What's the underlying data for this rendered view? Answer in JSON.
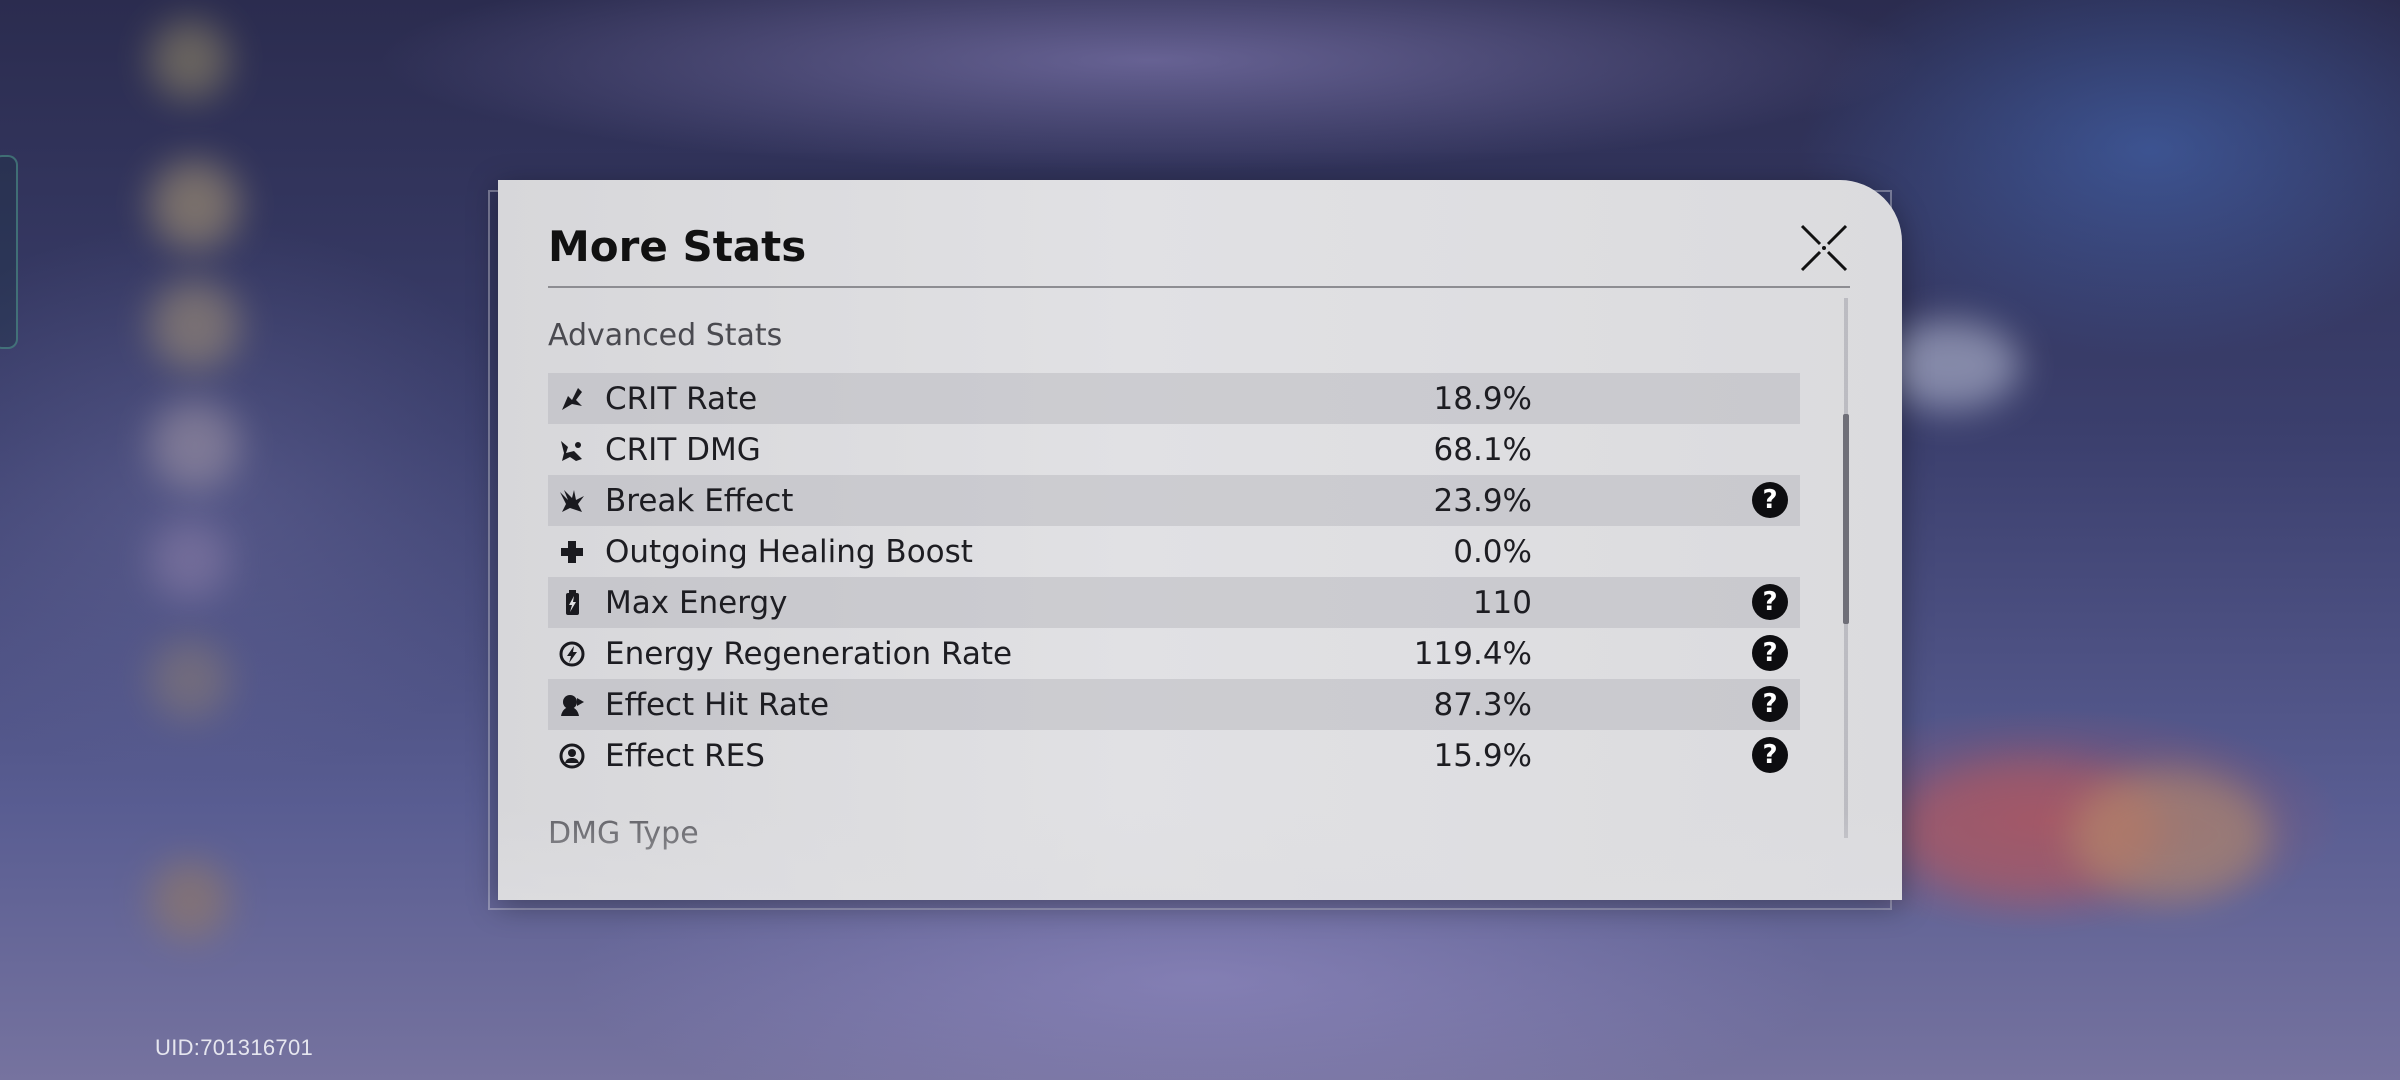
{
  "modal": {
    "title": "More Stats",
    "close_icon": "close-x-icon"
  },
  "advanced_stats": {
    "heading": "Advanced Stats",
    "rows": [
      {
        "label": "CRIT Rate",
        "value": "18.9%",
        "icon": "crit-rate-icon",
        "help": false
      },
      {
        "label": "CRIT DMG",
        "value": "68.1%",
        "icon": "crit-dmg-icon",
        "help": false
      },
      {
        "label": "Break Effect",
        "value": "23.9%",
        "icon": "break-effect-icon",
        "help": true
      },
      {
        "label": "Outgoing Healing Boost",
        "value": "0.0%",
        "icon": "healing-cross-icon",
        "help": false
      },
      {
        "label": "Max Energy",
        "value": "110",
        "icon": "battery-icon",
        "help": true
      },
      {
        "label": "Energy Regeneration Rate",
        "value": "119.4%",
        "icon": "energy-regen-icon",
        "help": true
      },
      {
        "label": "Effect Hit Rate",
        "value": "87.3%",
        "icon": "effect-hit-icon",
        "help": true
      },
      {
        "label": "Effect RES",
        "value": "15.9%",
        "icon": "effect-res-icon",
        "help": true
      }
    ],
    "help_glyph": "?"
  },
  "dmg_type": {
    "heading": "DMG Type"
  },
  "footer": {
    "uid": "UID:701316701"
  }
}
